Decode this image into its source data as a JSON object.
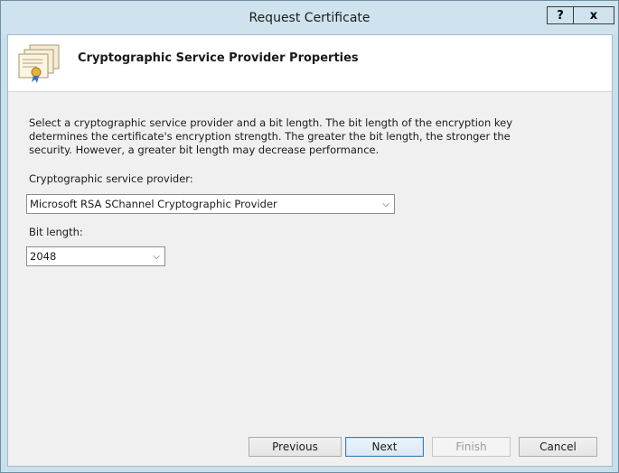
{
  "window": {
    "title": "Request Certificate",
    "help_label": "?",
    "close_label": "x"
  },
  "header": {
    "title": "Cryptographic Service Provider Properties"
  },
  "main": {
    "description": "Select a cryptographic service provider and a bit length. The bit length of the encryption key determines the certificate's encryption strength. The greater the bit length, the stronger the security. However, a greater bit length may decrease performance.",
    "csp_label": "Cryptographic service provider:",
    "csp_value": "Microsoft RSA SChannel Cryptographic Provider",
    "bit_label": "Bit length:",
    "bit_value": "2048"
  },
  "footer": {
    "previous_label": "Previous",
    "next_label": "Next",
    "finish_label": "Finish",
    "cancel_label": "Cancel"
  },
  "icons": {
    "certificate": "certificate-icon",
    "dropdown": "chevron-down-icon"
  }
}
